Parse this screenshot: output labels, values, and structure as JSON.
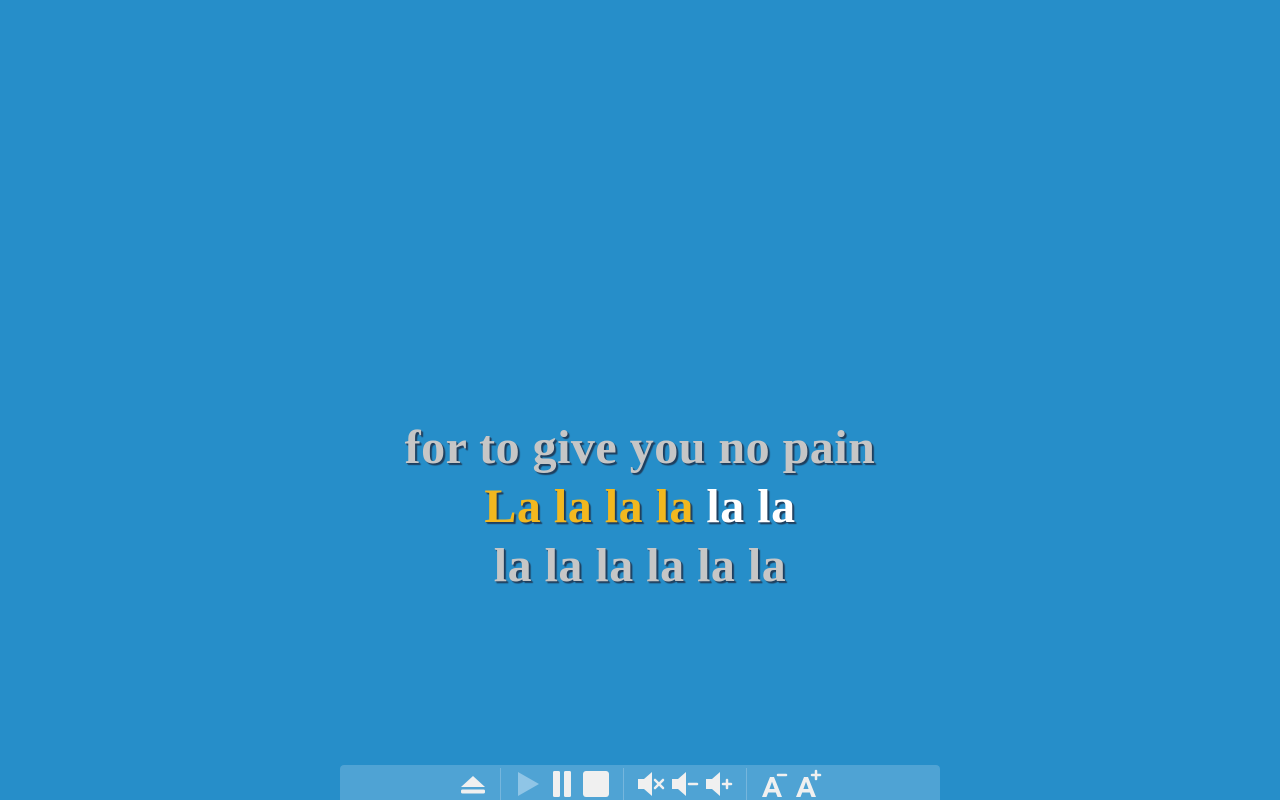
{
  "lyrics": {
    "previous_line": "for to give you no pain",
    "current_line": {
      "sung": "La la la la",
      "unsung": " la la"
    },
    "next_line": "la la la la la la"
  },
  "colors": {
    "background": "#268ec9",
    "sung": "#f2b81f",
    "unsung": "#ffffff",
    "inactive": "#c6c6c6",
    "toolbar": "#4fa3d4"
  },
  "toolbar": {
    "buttons": [
      {
        "name": "eject-icon",
        "enabled": true
      },
      {
        "name": "play-icon",
        "enabled": false
      },
      {
        "name": "pause-icon",
        "enabled": true
      },
      {
        "name": "stop-icon",
        "enabled": true
      },
      {
        "name": "mute-icon",
        "enabled": true
      },
      {
        "name": "volume-down-icon",
        "enabled": true
      },
      {
        "name": "volume-up-icon",
        "enabled": true
      },
      {
        "name": "font-smaller-icon",
        "enabled": true
      },
      {
        "name": "font-larger-icon",
        "enabled": true
      }
    ]
  }
}
